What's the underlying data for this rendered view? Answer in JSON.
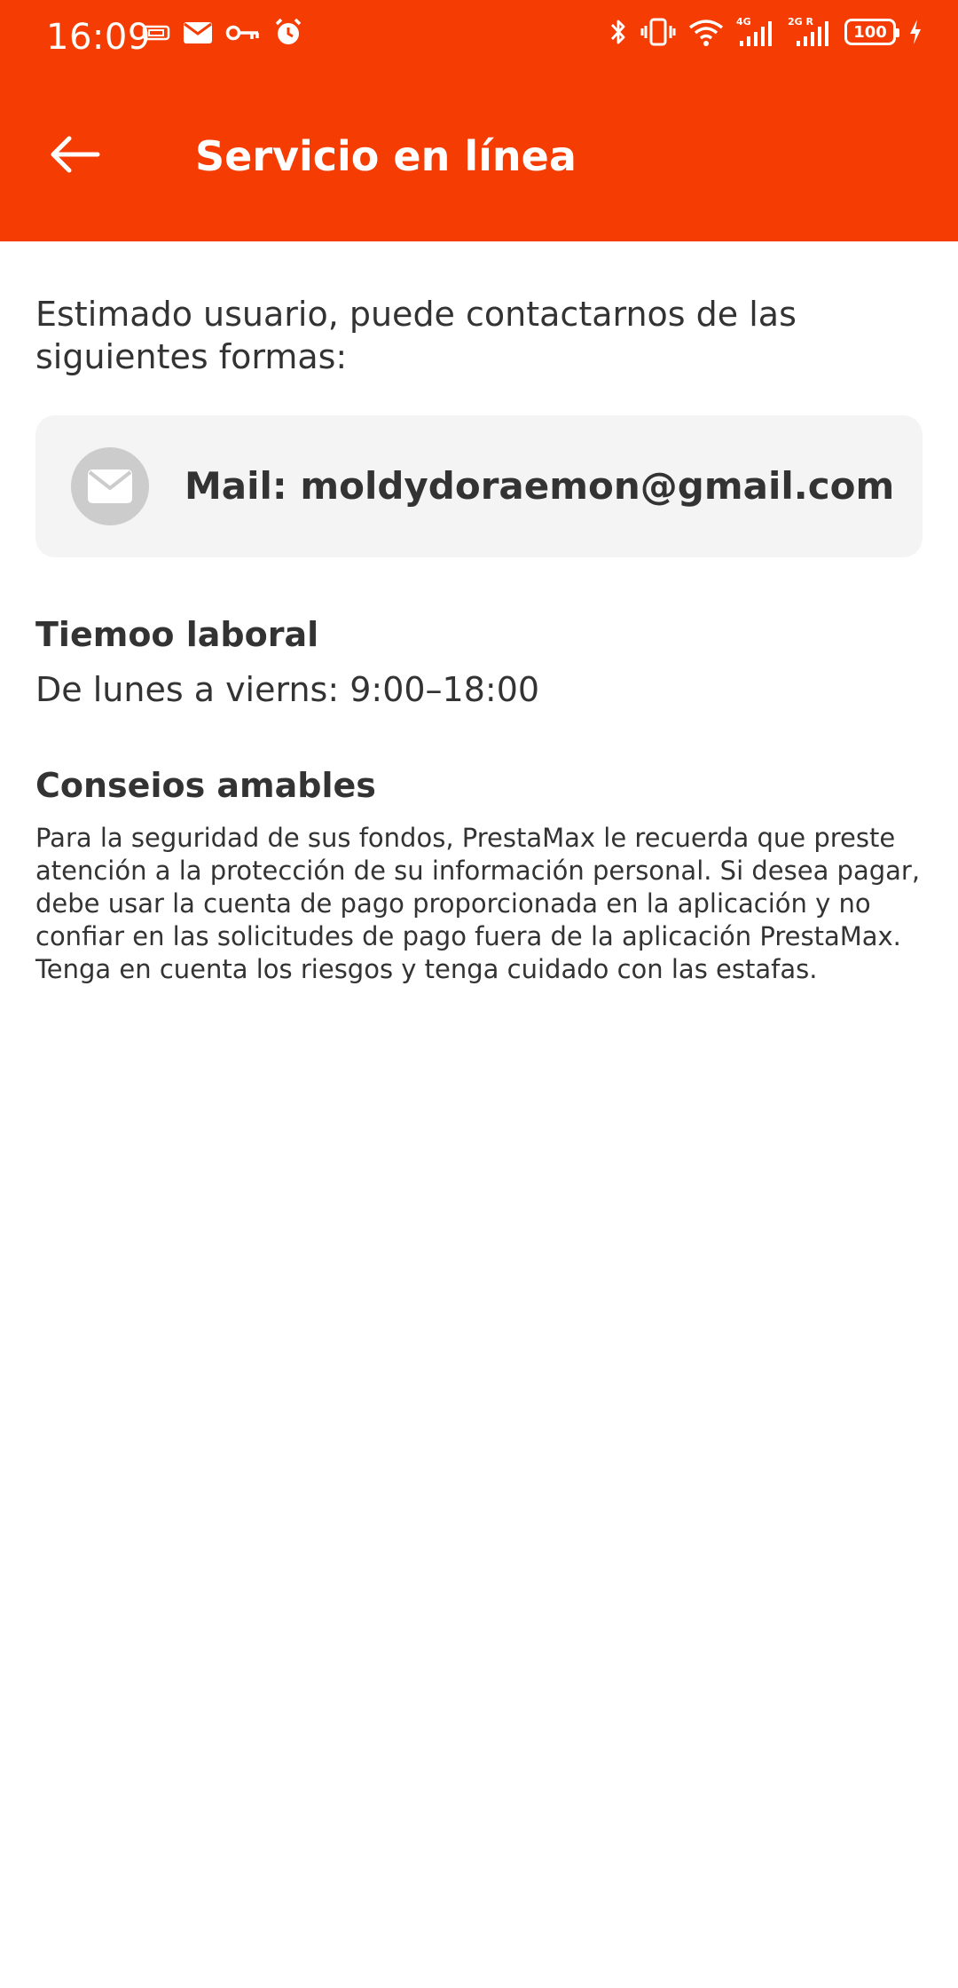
{
  "status_bar": {
    "time": "16:09",
    "battery": "100",
    "network_labels": [
      "4G",
      "2G R"
    ]
  },
  "app_bar": {
    "title": "Servicio en línea",
    "back_icon": "arrow-left-icon"
  },
  "content": {
    "intro": "Estimado usuario, puede contactarnos de las siguientes formas:",
    "mail": {
      "icon": "mail-icon",
      "label": "Mail: moldydoraemon@gmail.com"
    },
    "work_time": {
      "title": "Tiemoo laboral",
      "hours": "De lunes a vierns: 9:00–18:00"
    },
    "tips": {
      "title": "Conseios amables",
      "body": "Para la seguridad de sus fondos, PrestaMax le recuerda que preste atención a la protección de su información personal. Si desea pagar, debe usar la cuenta de pago proporcionada en la aplicación y no confiar en las solicitudes de pago fuera de la aplicación PrestaMax. Tenga en cuenta los riesgos y tenga cuidado con las estafas."
    }
  },
  "colors": {
    "header_bg": "#f53c02",
    "card_bg": "#f4f4f4",
    "text": "#333333",
    "icon_circle": "#cccccc"
  }
}
